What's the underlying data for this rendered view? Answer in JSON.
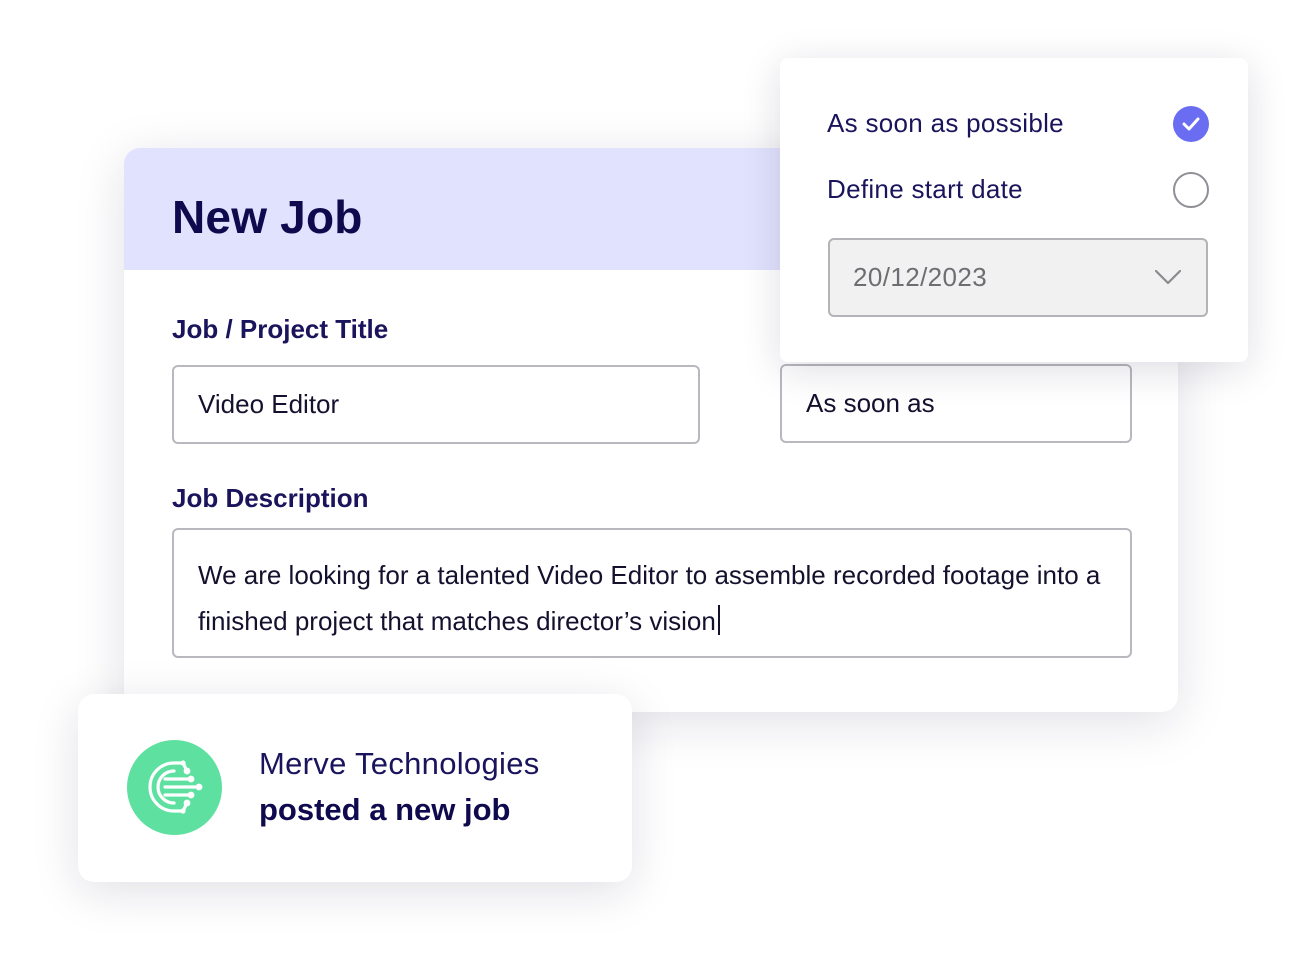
{
  "job_form": {
    "title": "New Job",
    "title_label": "Job / Project Title",
    "title_value": "Video Editor",
    "start_value": "As soon as",
    "description_label": "Job Description",
    "description_value": "We are looking for a talented Video Editor to assemble recorded footage into a finished project that matches director’s vision"
  },
  "start_popup": {
    "options": [
      {
        "label": "As soon as possible",
        "selected": true
      },
      {
        "label": "Define start date",
        "selected": false
      }
    ],
    "date_value": "20/12/2023"
  },
  "notification": {
    "company": "Merve Technologies",
    "action": "posted a new job",
    "logo_icon": "circuit-logo-icon"
  },
  "colors": {
    "header_bg": "#e1e2fd",
    "accent": "#6a6cf2",
    "text_dark": "#0f0a4e",
    "logo_green": "#5ee0a0"
  }
}
